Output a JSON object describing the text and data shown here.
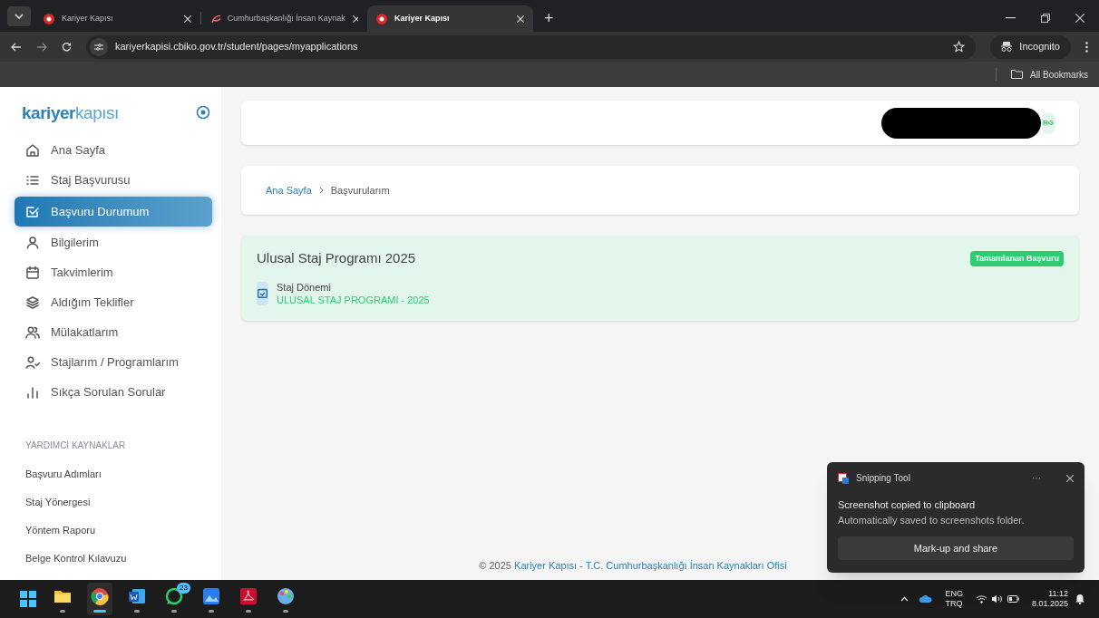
{
  "browser": {
    "tabs": [
      {
        "title": "Kariyer Kapısı",
        "selected": false
      },
      {
        "title": "Cumhurbaşkanlığı İnsan Kaynak",
        "selected": false
      },
      {
        "title": "Kariyer Kapısı",
        "selected": true
      }
    ],
    "new_tab": "+",
    "url": "kariyerkapisi.cbiko.gov.tr/student/pages/myapplications",
    "profile": "Incognito",
    "bookmarks": "All Bookmarks"
  },
  "sidebar": {
    "logo_bold": "kariyer",
    "logo_light": "kapısı",
    "items": [
      {
        "label": "Ana Sayfa",
        "selected": false
      },
      {
        "label": "Staj Başvurusu",
        "selected": false
      },
      {
        "label": "Başvuru Durumum",
        "selected": true
      },
      {
        "label": "Bilgilerim",
        "selected": false
      },
      {
        "label": "Takvimlerim",
        "selected": false
      },
      {
        "label": "Aldığım Teklifler",
        "selected": false
      },
      {
        "label": "Mülakatlarım",
        "selected": false
      },
      {
        "label": "Stajlarım / Programlarım",
        "selected": false
      },
      {
        "label": "Sıkça Sorulan Sorular",
        "selected": false
      }
    ],
    "section_title": "YARDIMCI KAYNAKLAR",
    "links": [
      "Başvuru Adımları",
      "Staj Yönergesi",
      "Yöntem Raporu",
      "Belge Kontrol Kılavuzu"
    ]
  },
  "header": {
    "avatar": "RG"
  },
  "breadcrumb": [
    "Ana Sayfa",
    "Başvurularım"
  ],
  "application": {
    "title": "Ulusal Staj Programı 2025",
    "status": "Tamamlanan Başvuru",
    "field_label": "Staj Dönemi",
    "field_value": "ULUSAL STAJ PROGRAMI - 2025"
  },
  "footer": {
    "year": "© 2025",
    "link": "Kariyer Kapısı - T.C. Cumhurbaşkanlığı İnsan Kaynakları Ofisi"
  },
  "toast": {
    "app": "Snipping Tool",
    "more": "···",
    "title": "Screenshot copied to clipboard",
    "body": "Automatically saved to screenshots folder.",
    "button": "Mark-up and share"
  },
  "taskbar": {
    "apps": [
      {
        "selected": false
      },
      {
        "selected": true
      },
      {
        "selected": false
      },
      {
        "selected": false,
        "badge": "23"
      },
      {
        "selected": false
      },
      {
        "selected": false
      },
      {
        "selected": false
      }
    ],
    "lang": "ENG",
    "layout": "TRQ",
    "time": "11:12",
    "date": "8.01.2025"
  }
}
